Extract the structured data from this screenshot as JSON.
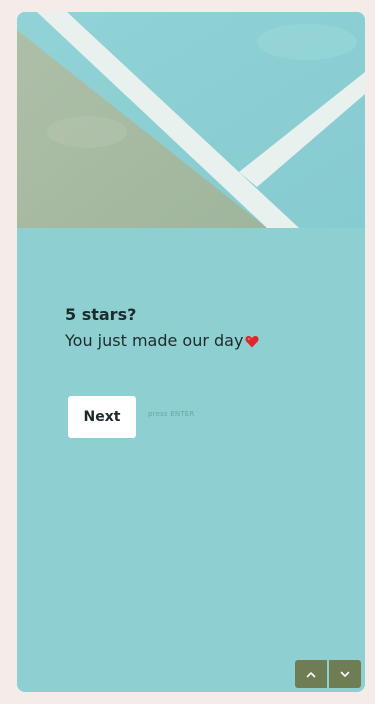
{
  "question": {
    "title": "5 stars?",
    "subtitle": "You just made our day"
  },
  "actions": {
    "next_label": "Next",
    "hint": "press ENTER"
  },
  "icons": {
    "heart": "heart-icon",
    "up": "chevron-up-icon",
    "down": "chevron-down-icon"
  },
  "colors": {
    "card_background": "#8ecfd1",
    "nav_button": "#6f7d54",
    "heart": "#e0262c"
  }
}
